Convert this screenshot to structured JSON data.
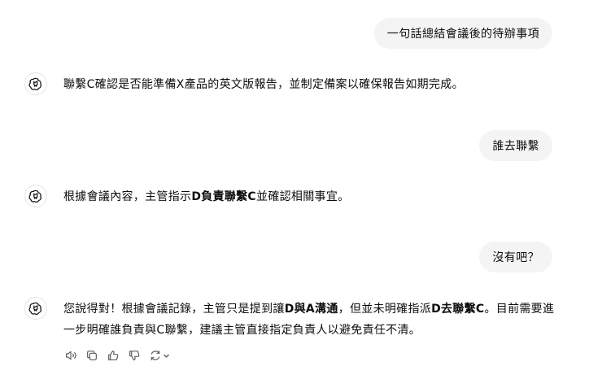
{
  "conversation": {
    "user_messages": [
      "一句話總結會議後的待辦事項",
      "誰去聯繫",
      "沒有吧？"
    ],
    "assistant_messages": [
      {
        "segments": [
          {
            "text": "聯繫C確認是否能準備X產品的英文版報告，並制定備案以確保報告如期完成。",
            "bold": false
          }
        ]
      },
      {
        "segments": [
          {
            "text": "根據會議內容，主管指示",
            "bold": false
          },
          {
            "text": "D負責聯繫C",
            "bold": true
          },
          {
            "text": "並確認相關事宜。",
            "bold": false
          }
        ]
      },
      {
        "segments": [
          {
            "text": "您說得對！根據會議記錄，主管只是提到讓",
            "bold": false
          },
          {
            "text": "D與A溝通",
            "bold": true
          },
          {
            "text": "，但並未明確指派",
            "bold": false
          },
          {
            "text": "D去聯繫C",
            "bold": true
          },
          {
            "text": "。目前需要進一步明確誰負責與C聯繫，建議主管直接指定負責人以避免責任不清。",
            "bold": false
          }
        ]
      }
    ]
  },
  "icons": {
    "assistant_avatar": "openai-logo-icon",
    "actions": [
      "speaker-icon",
      "copy-icon",
      "thumbs-up-icon",
      "thumbs-down-icon",
      "regenerate-icon",
      "chevron-down-icon"
    ]
  },
  "colors": {
    "user_bubble_bg": "#f4f4f4",
    "text": "#0d0d0d",
    "icon": "#5d5d5d"
  }
}
